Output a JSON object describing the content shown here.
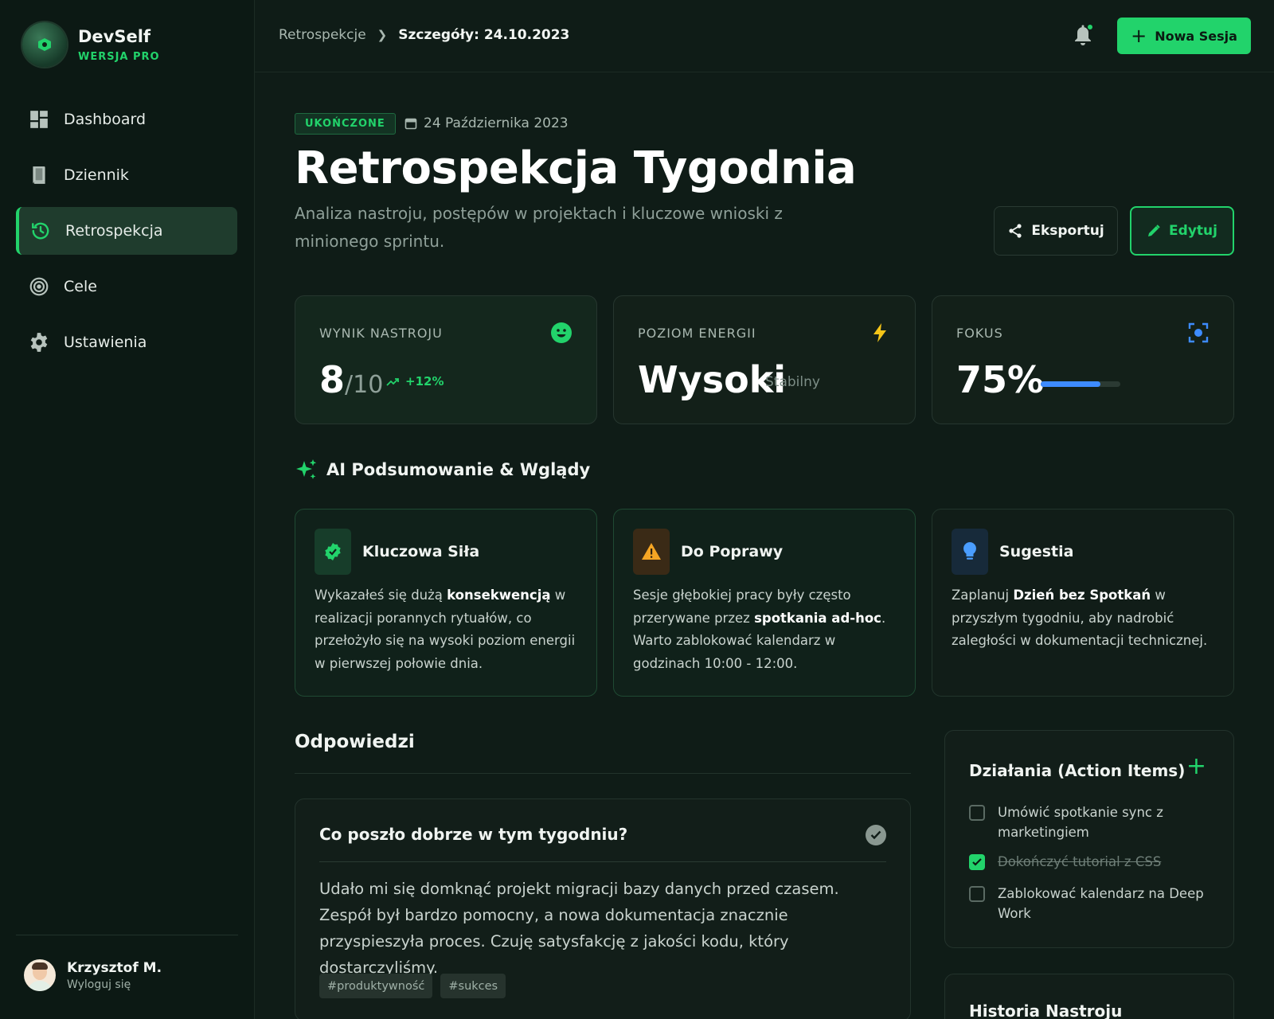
{
  "brand": {
    "name": "DevSelf",
    "tier": "WERSJA PRO"
  },
  "nav": [
    {
      "label": "Dashboard",
      "icon": "dashboard-icon"
    },
    {
      "label": "Dziennik",
      "icon": "book-icon"
    },
    {
      "label": "Retrospekcja",
      "icon": "history-icon",
      "active": true
    },
    {
      "label": "Cele",
      "icon": "target-icon"
    },
    {
      "label": "Ustawienia",
      "icon": "gear-icon"
    }
  ],
  "user": {
    "name": "Krzysztof M.",
    "logout": "Wyloguj się"
  },
  "breadcrumb": {
    "parent": "Retrospekcje",
    "current": "Szczegóły: 24.10.2023"
  },
  "header": {
    "new_session": "Nowa Sesja"
  },
  "page": {
    "status": "UKOŃCZONE",
    "date": "24 Października 2023",
    "title": "Retrospekcja Tygodnia",
    "subtitle": "Analiza nastroju, postępów w projektach i kluczowe wnioski z minionego sprintu.",
    "export": "Eksportuj",
    "edit": "Edytuj"
  },
  "stats": {
    "mood": {
      "label": "WYNIK NASTROJU",
      "value": "8",
      "unit": "/10",
      "trend": "+12%"
    },
    "energy": {
      "label": "POZIOM ENERGII",
      "value": "Wysoki",
      "note": "Stabilny"
    },
    "focus": {
      "label": "FOKUS",
      "value": "75%",
      "progress": 0.75
    }
  },
  "ai": {
    "heading": "AI Podsumowanie & Wglądy",
    "cards": [
      {
        "title": "Kluczowa Siła",
        "t1": "Wykazałeś się dużą ",
        "b1": "konsekwencją",
        "t2": " w realizacji porannych rytuałów, co przełożyło się na wysoki poziom energii w pierwszej połowie dnia."
      },
      {
        "title": "Do Poprawy",
        "t1": "Sesje głębokiej pracy były często przerywane przez ",
        "b1": "spotkania ad-hoc",
        "t2": ". Warto zablokować kalendarz w godzinach 10:00 - 12:00."
      },
      {
        "title": "Sugestia",
        "t1": "Zaplanuj ",
        "b1": "Dzień bez Spotkań",
        "t2": " w przyszłym tygodniu, aby nadrobić zaległości w dokumentacji technicznej."
      }
    ]
  },
  "answers": {
    "title": "Odpowiedzi",
    "items": [
      {
        "question": "Co poszło dobrze w tym tygodniu?",
        "answer": "Udało mi się domknąć projekt migracji bazy danych przed czasem. Zespół był bardzo pomocny, a nowa dokumentacja znacznie przyspieszyła proces. Czuję satysfakcję z jakości kodu, który dostarczyliśmy.",
        "tags": [
          "#produktywność",
          "#sukces"
        ]
      }
    ]
  },
  "actions": {
    "title": "Działania (Action Items)",
    "items": [
      {
        "label": "Umówić spotkanie sync z marketingiem",
        "done": false
      },
      {
        "label": "Dokończyć tutorial z CSS",
        "done": true
      },
      {
        "label": "Zablokować kalendarz na Deep Work",
        "done": false
      }
    ]
  },
  "history": {
    "title": "Historia Nastroju"
  },
  "colors": {
    "accent": "#22d36b",
    "warning": "#f5a524",
    "info": "#3d8bff",
    "background": "#0f1c17"
  }
}
